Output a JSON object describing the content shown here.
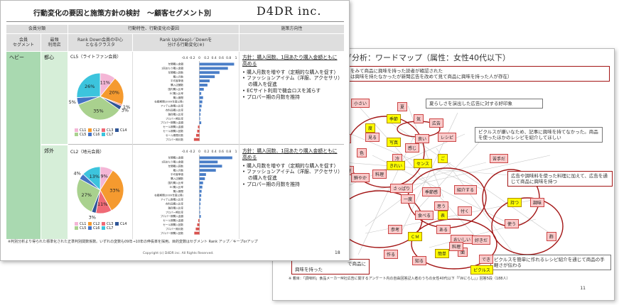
{
  "slide_back": {
    "title": "グ分析：ワードマップ（属性：女性40代以下）",
    "top_note_line1": "をみて商品に興味を持った読者が確認された",
    "top_note_line2": "は興味を持たなかったが新聞広告を改めて見て商品に興味を持った人が存在）",
    "anno_1": "夏らしさを演出した広告に対する好印象",
    "anno_2": "ピクルスが嫌いなため、記事に興味を持てなかった。商品を使ったほかのレシピを紹介してほしい",
    "anno_3": "広告や調味料を使った料理に加えて、広告を通じて商品に興味を持つ",
    "anno_4": "ピクルスを簡単に作れるレシピ紹介を通じて商品の手軽さが伝わる",
    "anno_5_line1": "で商品に",
    "anno_5_line2": "興味を持った",
    "nodes": [
      "小さい",
      "夏",
      "季節",
      "気",
      "度",
      "写真",
      "見る",
      "使う",
      "良い",
      "感じ",
      "広告",
      "センス",
      "ご",
      "レシピ",
      "冷",
      "きれい",
      "料理",
      "色",
      "好",
      "さっぱり",
      "一度",
      "季節感",
      "鮮やか",
      "紹介する",
      "食べる",
      "表",
      "思う",
      "付く",
      "ある",
      "おいしい",
      "参考",
      "ＣＭ",
      "簡単",
      "作る",
      "知る",
      "好きだ",
      "面",
      "料理",
      "でき",
      "ピクルス",
      "苦手だ",
      "持つ",
      "調味",
      "使う",
      "酢"
    ],
    "footnote": "※ 着目：「調味料」食品メーカーM社広告に関するアンケート内の自由回答記入者のうちの女性40代以下「「Ｗにらし」」回答5段（188人）",
    "page": "11"
  },
  "slide_front": {
    "title": "行動変化の要因と施策方針の検討　～顧客セグメント別",
    "logo": "D4DR inc.",
    "headers": {
      "member_category": "会員分類",
      "behavior_factor": "行動特性、行動変化の要因",
      "policy_direction": "施策方向性",
      "member_segment": "会員\nセグメント",
      "store": "最頻\n利用店",
      "rank_down_cluster": "Rank Down会員の中心\nとなるクラスタ",
      "rank_up_down": "Rank Up(Keep)／Downを\n分ける行動変化(※)"
    },
    "segment": "ヘビー",
    "rows": [
      {
        "store": "都心",
        "cluster_label": "CL5（ライトファン会員）",
        "pie": [
          {
            "name": "CL1",
            "value": 11,
            "label": "11%"
          },
          {
            "name": "CL2",
            "value": 20,
            "label": "20%"
          },
          {
            "name": "CL3",
            "value": 1,
            "label": "1%"
          },
          {
            "name": "CL4",
            "value": 3,
            "label": "3%"
          },
          {
            "name": "CL5",
            "value": 35,
            "label": "35%"
          },
          {
            "name": "CL6",
            "value": 5,
            "label": "5%"
          },
          {
            "name": "CL7",
            "value": 26,
            "label": "26%"
          }
        ],
        "policy_head": "方針：購入回数、1回あたり購入金額ともに高める",
        "policy_items": [
          "購入月数を増やす（定期的な購入を促す）",
          "ファッションアイテム（洋服、アクセサリ）の購入を促進",
          "ECサイト利用で機会ロスを減らす",
          "プロパー期の月数を推持"
        ]
      },
      {
        "store": "郊外",
        "cluster_label": "CL2（地元会員）",
        "pie": [
          {
            "name": "CL1",
            "value": 9,
            "label": "9%"
          },
          {
            "name": "CL2",
            "value": 33,
            "label": "33%"
          },
          {
            "name": "CL3",
            "value": 11,
            "label": "11%"
          },
          {
            "name": "CL4",
            "value": 3,
            "label": "3%"
          },
          {
            "name": "CL5",
            "value": 27,
            "label": "27%"
          },
          {
            "name": "CL6",
            "value": 4,
            "label": "4%"
          },
          {
            "name": "CL7",
            "value": 13,
            "label": "13%"
          }
        ],
        "policy_head": "方針：購入回数、1回あたり購入金額ともに高める",
        "policy_items": [
          "購入月数を増やす（定期的な購入を促す）",
          "ファッションアイテム（洋服、アクセサリ）の購入を促進",
          "プロパー期の月数を推持"
        ]
      }
    ],
    "pie_colors": {
      "CL1": "#f4b6d6",
      "CL2": "#f59a2f",
      "CL3": "#ef6a76",
      "CL4": "#2f5597",
      "CL5": "#a9d18e",
      "CL6": "#4472c4",
      "CL7": "#3cc4dd"
    },
    "bar_axis_ticks": [
      "-0.4",
      "-0.2",
      "0",
      "0.2",
      "0.4",
      "0.6",
      "0.8",
      "1"
    ],
    "bar_rows_top": [
      "年間購入金額",
      "1回あたり購入金額",
      "年間購入回数",
      "購入月数",
      "平均客単価",
      "購入店舗数",
      "国内購入比率",
      "EC購入比率",
      "購入期間",
      "在籍期間(2009年度以降)",
      "アイテム数購入比率",
      "衣料品購入比率",
      "雑貨購入比率",
      "プロパー期比率",
      "プロパー期購入金額",
      "セール期購入金額",
      "セール期購入回数",
      "セール期間月数",
      "プロパー期月数"
    ],
    "bar_values_top": [
      0.95,
      0.78,
      0.55,
      0.42,
      0.28,
      0.22,
      0.12,
      0.05,
      0.1,
      0.08,
      0.06,
      0.04,
      0.03,
      0.02,
      0.05,
      -0.04,
      -0.06,
      -0.09,
      -0.15
    ],
    "bar_rows_bottom": [
      "年間購入金額",
      "1回あたり購入金額",
      "年間購入回数",
      "購入月数",
      "平均客単価",
      "購入店舗数",
      "国内購入比率",
      "EC購入比率",
      "購入期間",
      "在籍期間(2009年度以降)",
      "アイテム数購入比率",
      "衣料品購入比率",
      "雑貨購入比率",
      "プロパー期比率",
      "プロパー期購入金額",
      "セール期購入金額",
      "セール期購入回数",
      "プロパー期月数",
      "プロパー期購入回数"
    ],
    "bar_values_bottom": [
      0.9,
      0.5,
      0.62,
      0.45,
      0.18,
      0.15,
      0.1,
      0.08,
      0.06,
      0.05,
      0.04,
      0.03,
      0.02,
      0.02,
      0.04,
      -0.03,
      -0.06,
      -0.1,
      -0.14
    ],
    "footnote": "※判別分析より得られた標準化された正準判別関数係数。いずれの変数も09年→10年の伸長率を採用。目的変数はセグメント Rank アップ／キープorアップ",
    "copyright": "Copyright (c) D4DR inc. All Rights Reserved.",
    "page": "18"
  }
}
